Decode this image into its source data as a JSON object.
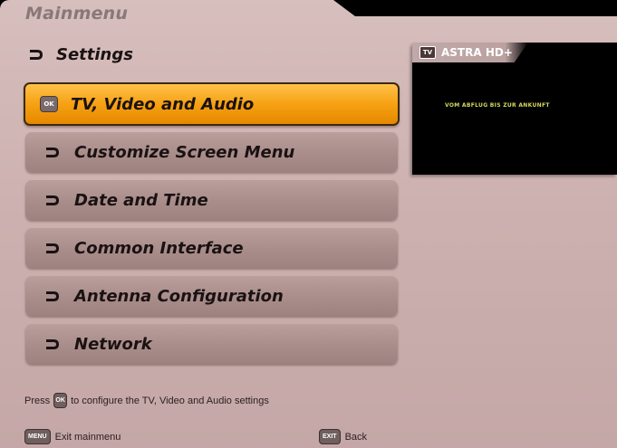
{
  "header": {
    "title": "Mainmenu",
    "subtitle": "Settings"
  },
  "menu": {
    "items": [
      {
        "label": "TV, Video and Audio",
        "selected": true
      },
      {
        "label": "Customize Screen Menu",
        "selected": false
      },
      {
        "label": "Date and Time",
        "selected": false
      },
      {
        "label": "Common Interface",
        "selected": false
      },
      {
        "label": "Antenna Configuration",
        "selected": false
      },
      {
        "label": "Network",
        "selected": false
      }
    ],
    "ok_key": "OK"
  },
  "preview": {
    "tv_badge": "TV",
    "channel": "ASTRA HD+",
    "program_text": "VOM ABFLUG BIS ZUR ANKUNFT"
  },
  "hint": {
    "before": "Press",
    "key": "OK",
    "after": "to configure the TV, Video and Audio settings"
  },
  "footer": {
    "menu_key": "MENU",
    "menu_label": "Exit mainmenu",
    "exit_key": "EXIT",
    "exit_label": "Back"
  },
  "colors": {
    "panel": "#ccb1b0",
    "selected": "#f6a113",
    "item": "#a98d8b"
  }
}
